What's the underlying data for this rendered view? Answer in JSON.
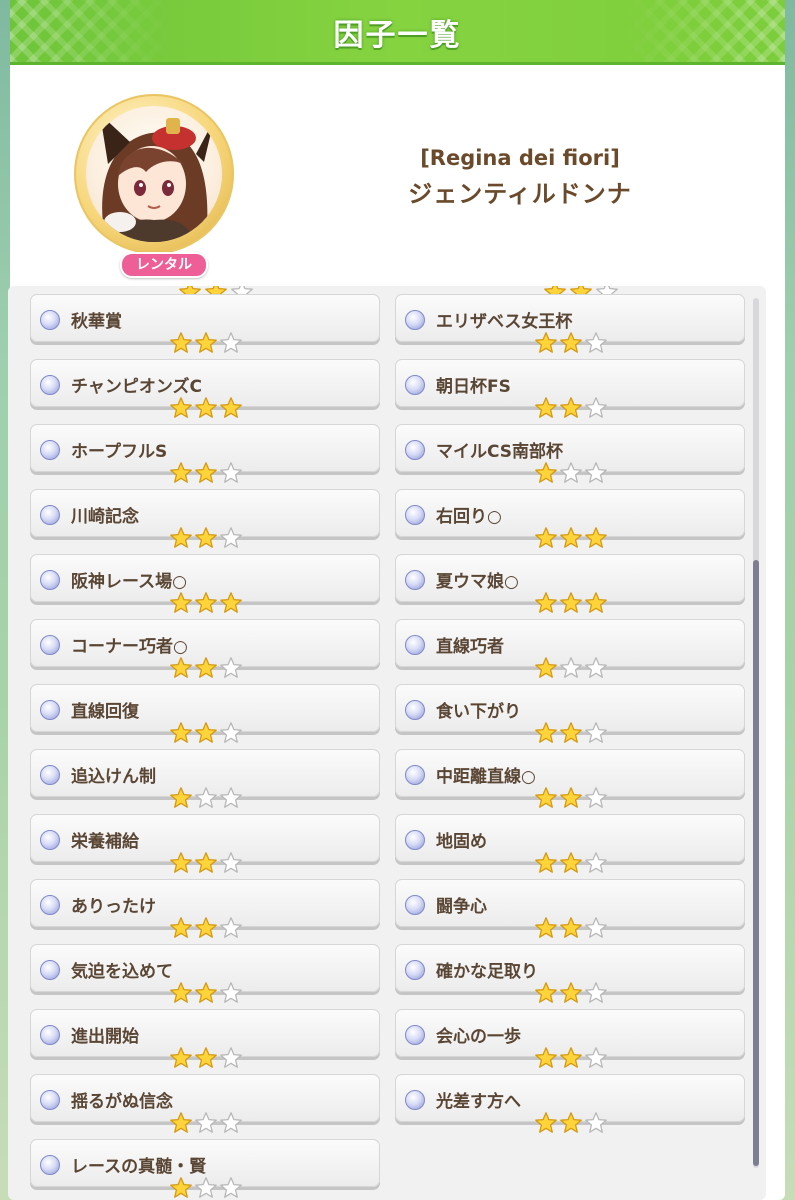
{
  "header": {
    "title": "因子一覧"
  },
  "character": {
    "costume": "[Regina dei fiori]",
    "name": "ジェンティルドンナ",
    "badge": "レンタル"
  },
  "colors": {
    "header_green": "#7ccd3b",
    "badge_pink": "#ee5f97",
    "text_brown": "#5a4634",
    "star_gold": "#ffd43a",
    "star_empty": "#ffffff"
  },
  "factors": {
    "left": [
      {
        "label": "秋華賞",
        "stars": 2
      },
      {
        "label": "チャンピオンズC",
        "stars": 3
      },
      {
        "label": "ホープフルS",
        "stars": 2
      },
      {
        "label": "川崎記念",
        "stars": 2
      },
      {
        "label": "阪神レース場○",
        "stars": 3
      },
      {
        "label": "コーナー巧者○",
        "stars": 2
      },
      {
        "label": "直線回復",
        "stars": 2
      },
      {
        "label": "追込けん制",
        "stars": 1
      },
      {
        "label": "栄養補給",
        "stars": 2
      },
      {
        "label": "ありったけ",
        "stars": 2
      },
      {
        "label": "気迫を込めて",
        "stars": 2
      },
      {
        "label": "進出開始",
        "stars": 2
      },
      {
        "label": "揺るがぬ信念",
        "stars": 1
      },
      {
        "label": "レースの真髄・賢",
        "stars": 1
      }
    ],
    "right": [
      {
        "label": "エリザベス女王杯",
        "stars": 2
      },
      {
        "label": "朝日杯FS",
        "stars": 2
      },
      {
        "label": "マイルCS南部杯",
        "stars": 1
      },
      {
        "label": "右回り○",
        "stars": 3
      },
      {
        "label": "夏ウマ娘○",
        "stars": 3
      },
      {
        "label": "直線巧者",
        "stars": 1
      },
      {
        "label": "食い下がり",
        "stars": 2
      },
      {
        "label": "中距離直線○",
        "stars": 2
      },
      {
        "label": "地固め",
        "stars": 2
      },
      {
        "label": "闘争心",
        "stars": 2
      },
      {
        "label": "確かな足取り",
        "stars": 2
      },
      {
        "label": "会心の一歩",
        "stars": 2
      },
      {
        "label": "光差す方へ",
        "stars": 2
      }
    ]
  },
  "icons": {
    "bullet": "factor-bullet-icon",
    "star_filled": "star-filled-icon",
    "star_empty": "star-empty-icon"
  }
}
